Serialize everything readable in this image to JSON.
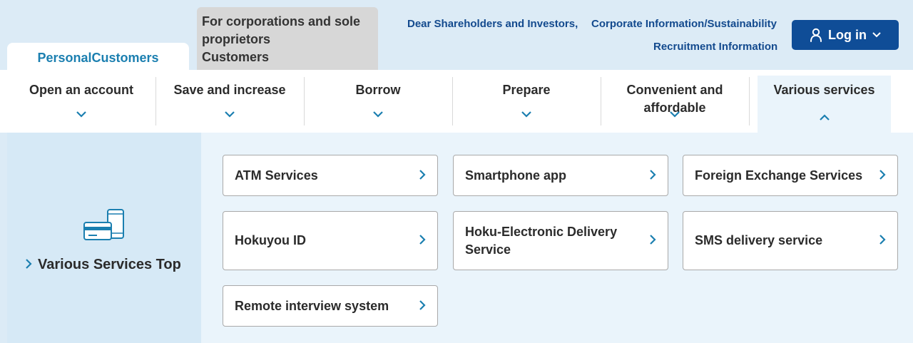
{
  "audience_tabs": {
    "personal": "PersonalCustomers",
    "corporate": [
      "For corporations and sole",
      "proprietors",
      "Customers"
    ]
  },
  "header_links": {
    "shareholders": "Dear Shareholders and Investors,",
    "corporate": "Corporate Information/Sustainability",
    "recruitment": "Recruitment Information"
  },
  "login": {
    "label": "Log in"
  },
  "nav": {
    "items": [
      {
        "label": "Open an account"
      },
      {
        "label": "Save and increase"
      },
      {
        "label": "Borrow"
      },
      {
        "label": "Prepare"
      },
      {
        "label": "Convenient and affordable"
      },
      {
        "label": "Various services"
      }
    ],
    "active_index": 5
  },
  "panel": {
    "side_link": "Various Services Top",
    "cards": [
      {
        "label": "ATM Services"
      },
      {
        "label": "Smartphone app"
      },
      {
        "label": "Foreign Exchange Services"
      },
      {
        "label": "Hokuyou ID"
      },
      {
        "label": "Hoku-Electronic Delivery Service"
      },
      {
        "label": "SMS delivery service"
      },
      {
        "label": "Remote interview system"
      }
    ]
  },
  "colors": {
    "accent": "#1b7fb0",
    "link": "#134a8e",
    "login_bg": "#0f4d97",
    "page_bg": "#dcebf6",
    "panel_bg": "#eaf4fb"
  },
  "icons": {
    "login": "user-icon",
    "chevron": "chevron-down-icon",
    "arrow": "chevron-right-icon",
    "services": "card-phone-icon"
  }
}
